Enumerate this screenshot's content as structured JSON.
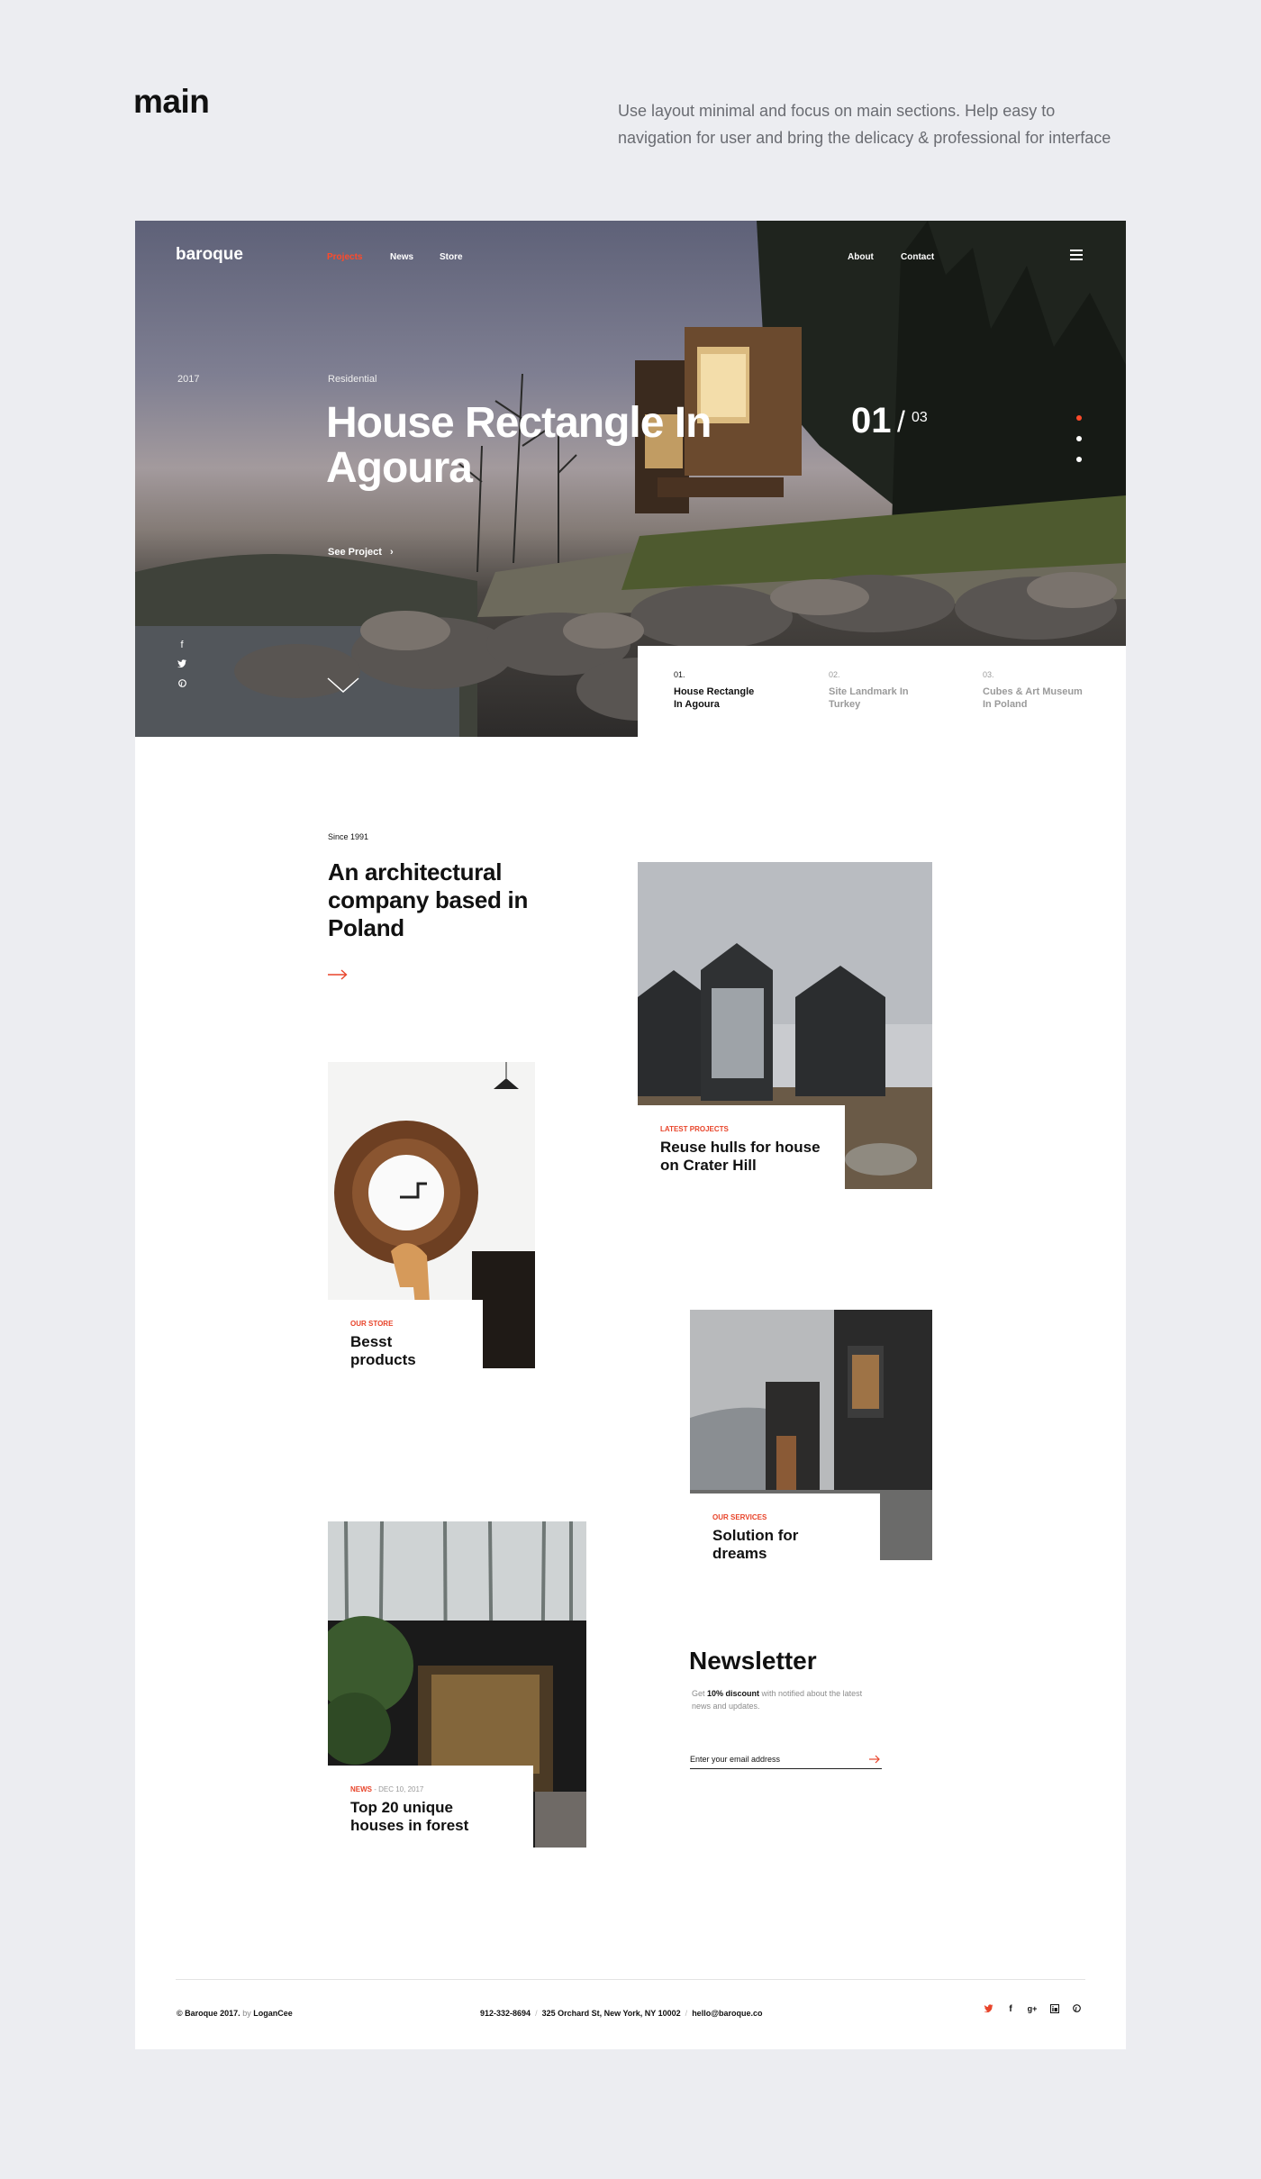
{
  "page": {
    "heading": "main",
    "description": "Use layout minimal and focus on main sections. Help easy to navigation for user and bring the delicacy & professional for interface"
  },
  "header": {
    "logo": "baroque",
    "nav_left": [
      "Projects",
      "News",
      "Store"
    ],
    "nav_right": [
      "About",
      "Contact"
    ]
  },
  "hero": {
    "year": "2017",
    "category": "Residential",
    "title": "House Rectangle In Agoura",
    "slide_current": "01",
    "slide_separator": "/",
    "slide_total": "03",
    "cta": "See Project",
    "active_dot": 1,
    "socials": [
      "facebook-icon",
      "twitter-icon",
      "pinterest-icon"
    ]
  },
  "slides": [
    {
      "num": "01.",
      "name": "House Rectangle In Agoura"
    },
    {
      "num": "02.",
      "name": "Site Landmark In Turkey"
    },
    {
      "num": "03.",
      "name": "Cubes & Art Museum In Poland"
    }
  ],
  "about": {
    "since": "Since 1991",
    "title": "An architectural company based in Poland"
  },
  "cards": {
    "latest": {
      "tag": "LATEST PROJECTS",
      "title": "Reuse hulls for house on Crater Hill"
    },
    "store": {
      "tag": "OUR STORE",
      "title": "Besst products"
    },
    "services": {
      "tag": "OUR SERVICES",
      "title": "Solution for dreams"
    },
    "news": {
      "tag": "NEWS",
      "date": "- DEC 10, 2017",
      "title": "Top 20 unique houses in forest"
    }
  },
  "newsletter": {
    "title": "Newsletter",
    "text_prefix": "Get ",
    "text_bold": "10% discount",
    "text_suffix": " with notified about the latest news and updates.",
    "placeholder": "Enter your email address"
  },
  "footer": {
    "copyright": "© Baroque 2017.",
    "by": "by",
    "author": "LoganCee",
    "phone": "912-332-8694",
    "address": "325 Orchard St, New York, NY 10002",
    "email": "hello@baroque.co",
    "sep": "/",
    "socials": [
      "twitter-icon",
      "facebook-icon",
      "google-plus-icon",
      "linkedin-icon",
      "pinterest-icon"
    ]
  },
  "colors": {
    "accent": "#ff4a2a",
    "background": "#ecedf1"
  }
}
